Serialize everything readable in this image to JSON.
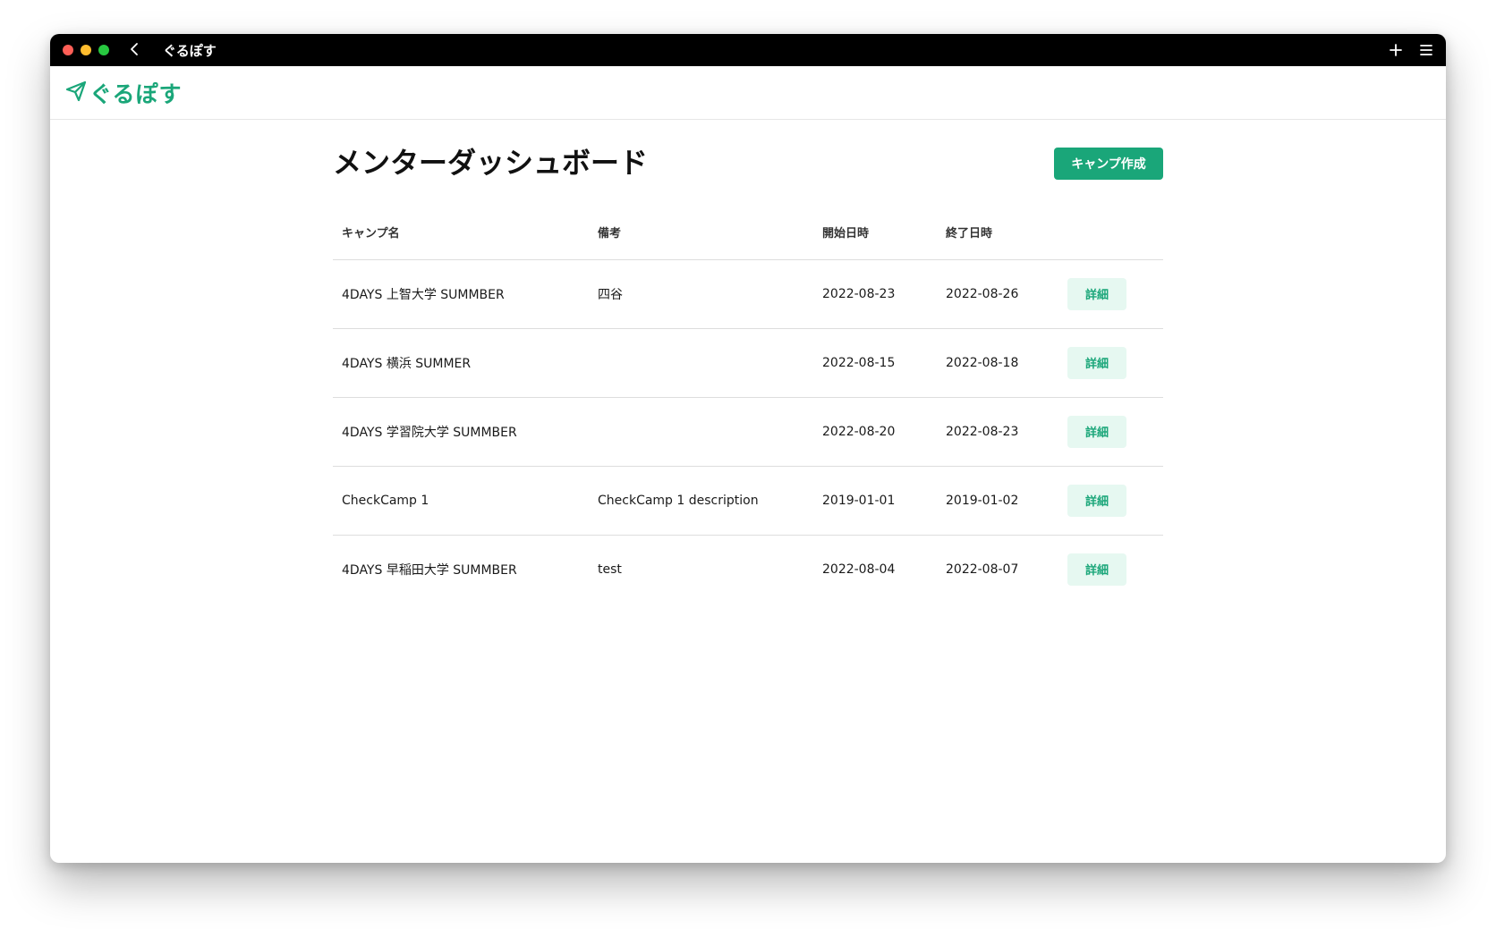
{
  "window": {
    "title": "ぐるぽす"
  },
  "app": {
    "logo_text": "ぐるぽす"
  },
  "page": {
    "title": "メンターダッシュボード",
    "create_button": "キャンプ作成"
  },
  "table": {
    "headers": [
      "キャンプ名",
      "備考",
      "開始日時",
      "終了日時",
      ""
    ],
    "rows": [
      {
        "name": "4DAYS 上智大学 SUMMBER",
        "note": "四谷",
        "start": "2022-08-23",
        "end": "2022-08-26",
        "action": "詳細"
      },
      {
        "name": "4DAYS 横浜 SUMMER",
        "note": "",
        "start": "2022-08-15",
        "end": "2022-08-18",
        "action": "詳細"
      },
      {
        "name": "4DAYS 学習院大学 SUMMBER",
        "note": "",
        "start": "2022-08-20",
        "end": "2022-08-23",
        "action": "詳細"
      },
      {
        "name": "CheckCamp 1",
        "note": "CheckCamp 1 description",
        "start": "2019-01-01",
        "end": "2019-01-02",
        "action": "詳細"
      },
      {
        "name": "4DAYS 早稲田大学 SUMMBER",
        "note": "test",
        "start": "2022-08-04",
        "end": "2022-08-07",
        "action": "詳細"
      }
    ]
  },
  "icons": {
    "back": "chevron-left-icon",
    "add": "plus-icon",
    "menu": "hamburger-menu-icon",
    "logo": "paper-plane-icon"
  },
  "colors": {
    "accent": "#1aa679",
    "accent_light": "#e6f8f1",
    "titlebar": "#000000"
  }
}
